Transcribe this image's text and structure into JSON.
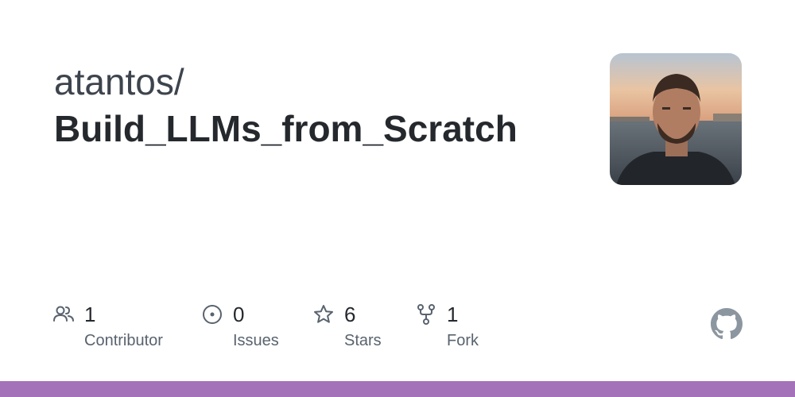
{
  "header": {
    "owner": "atantos/",
    "repo": "Build_LLMs_from_Scratch"
  },
  "stats": [
    {
      "icon": "contributors-icon",
      "count": "1",
      "label": "Contributor"
    },
    {
      "icon": "issues-icon",
      "count": "0",
      "label": "Issues"
    },
    {
      "icon": "star-icon",
      "count": "6",
      "label": "Stars"
    },
    {
      "icon": "fork-icon",
      "count": "1",
      "label": "Fork"
    }
  ],
  "colors": {
    "language_bar": "#a472b8",
    "text_primary": "#25292e",
    "text_secondary": "#59636e"
  }
}
